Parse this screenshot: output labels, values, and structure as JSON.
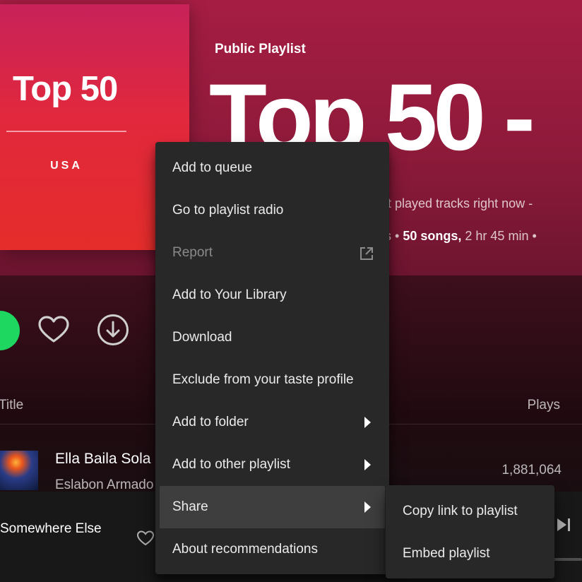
{
  "cover": {
    "title": "Top 50",
    "subtitle": "USA"
  },
  "header": {
    "eyebrow": "Public Playlist",
    "title": "Top 50 -",
    "description": "ost played tracks right now -",
    "meta_likes": "kes",
    "meta_songs": "50 songs,",
    "meta_duration": "2 hr 45 min",
    "meta_sep": "•"
  },
  "actions": {
    "like_icon": "heart-outline-icon",
    "download_icon": "download-circle-icon"
  },
  "tracklist": {
    "columns": {
      "title": "Title",
      "plays": "Plays"
    },
    "rows": [
      {
        "title": "Ella Baila Sola",
        "artist": "Eslabon Armado",
        "plays": "1,881,064"
      }
    ]
  },
  "player": {
    "now_playing_title": "Somewhere Else"
  },
  "context_menu": {
    "items": [
      {
        "label": "Add to queue"
      },
      {
        "label": "Go to playlist radio"
      },
      {
        "label": "Report",
        "disabled": true,
        "icon": "external-link-icon"
      },
      {
        "label": "Add to Your Library"
      },
      {
        "label": "Download"
      },
      {
        "label": "Exclude from your taste profile"
      },
      {
        "label": "Add to folder",
        "submenu": true
      },
      {
        "label": "Add to other playlist",
        "submenu": true
      },
      {
        "label": "Share",
        "submenu": true,
        "active": true
      },
      {
        "label": "About recommendations"
      }
    ]
  },
  "share_submenu": {
    "items": [
      {
        "label": "Copy link to playlist"
      },
      {
        "label": "Embed playlist"
      }
    ]
  },
  "colors": {
    "accent_green": "#1ed760",
    "menu_bg": "#282828",
    "menu_hover": "#3e3e3e",
    "header_gradient_top": "#a61d43"
  }
}
